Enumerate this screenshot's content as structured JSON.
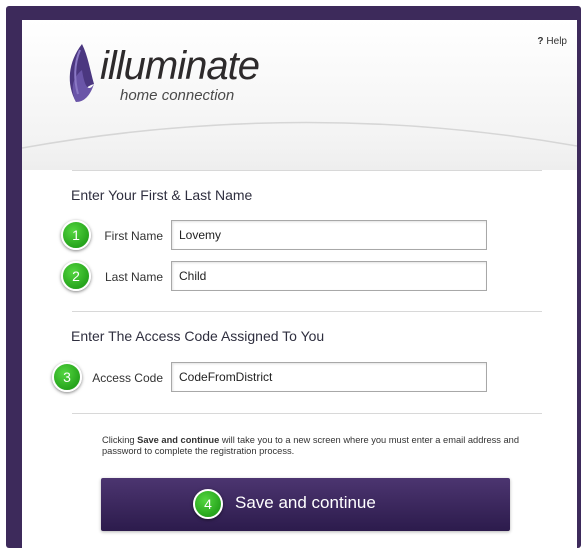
{
  "header": {
    "help_icon": "?",
    "help_label": "Help",
    "logo_name": "illuminate",
    "logo_tagline": "home connection"
  },
  "name_section": {
    "title": "Enter Your First & Last Name",
    "first_name": {
      "step": "1",
      "label": "First Name",
      "value": "Lovemy"
    },
    "last_name": {
      "step": "2",
      "label": "Last Name",
      "value": "Child"
    }
  },
  "code_section": {
    "title": "Enter The Access Code Assigned To You",
    "access_code": {
      "step": "3",
      "label": "Access Code",
      "value": "CodeFromDistrict"
    }
  },
  "notice": {
    "prefix": "Clicking ",
    "emphasis": "Save and continue",
    "suffix": " will take you to a new screen where you must enter a email address and password to complete the registration process."
  },
  "save_button": {
    "step": "4",
    "label": "Save and continue"
  },
  "colors": {
    "frame": "#3d2a5b",
    "button": "#3a2760",
    "badge": "#3cc02e",
    "logo_petal": "#4b3780"
  }
}
